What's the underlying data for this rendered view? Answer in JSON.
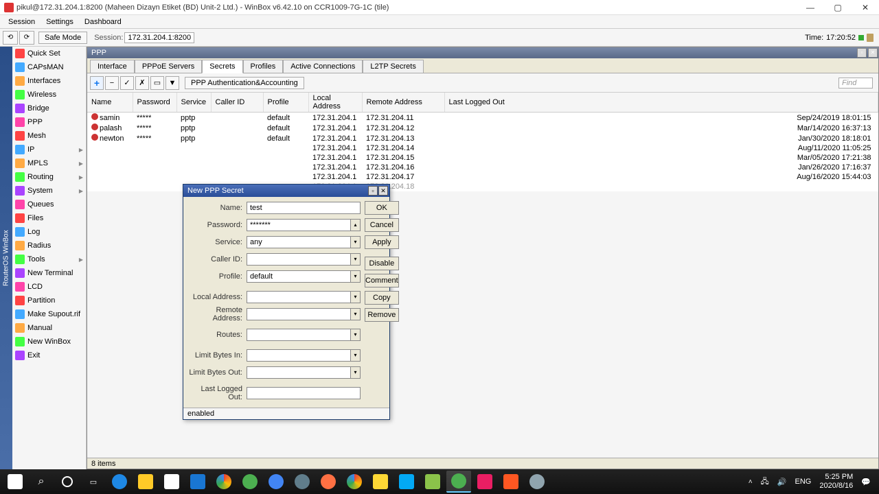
{
  "window": {
    "title": "pikul@172.31.204.1:8200 (Maheen Dizayn Etiket (BD) Unit-2 Ltd.) - WinBox v6.42.10 on CCR1009-7G-1C (tile)"
  },
  "menubar": [
    "Session",
    "Settings",
    "Dashboard"
  ],
  "toolbar": {
    "safe_mode": "Safe Mode",
    "session_label": "Session:",
    "session_value": "172.31.204.1:8200",
    "time_label": "Time:",
    "time_value": "17:20:52"
  },
  "sidebar": {
    "rail": "RouterOS WinBox",
    "items": [
      {
        "label": "Quick Set",
        "arrow": false
      },
      {
        "label": "CAPsMAN",
        "arrow": false
      },
      {
        "label": "Interfaces",
        "arrow": false
      },
      {
        "label": "Wireless",
        "arrow": false
      },
      {
        "label": "Bridge",
        "arrow": false
      },
      {
        "label": "PPP",
        "arrow": false
      },
      {
        "label": "Mesh",
        "arrow": false
      },
      {
        "label": "IP",
        "arrow": true
      },
      {
        "label": "MPLS",
        "arrow": true
      },
      {
        "label": "Routing",
        "arrow": true
      },
      {
        "label": "System",
        "arrow": true
      },
      {
        "label": "Queues",
        "arrow": false
      },
      {
        "label": "Files",
        "arrow": false
      },
      {
        "label": "Log",
        "arrow": false
      },
      {
        "label": "Radius",
        "arrow": false
      },
      {
        "label": "Tools",
        "arrow": true
      },
      {
        "label": "New Terminal",
        "arrow": false
      },
      {
        "label": "LCD",
        "arrow": false
      },
      {
        "label": "Partition",
        "arrow": false
      },
      {
        "label": "Make Supout.rif",
        "arrow": false
      },
      {
        "label": "Manual",
        "arrow": false
      },
      {
        "label": "New WinBox",
        "arrow": false
      },
      {
        "label": "Exit",
        "arrow": false
      }
    ]
  },
  "ppp": {
    "title": "PPP",
    "tabs": [
      "Interface",
      "PPPoE Servers",
      "Secrets",
      "Profiles",
      "Active Connections",
      "L2TP Secrets"
    ],
    "active_tab": 2,
    "auth_btn": "PPP Authentication&Accounting",
    "find_placeholder": "Find",
    "columns": [
      "Name",
      "Password",
      "Service",
      "Caller ID",
      "Profile",
      "Local Address",
      "Remote Address",
      "Last Logged Out"
    ],
    "rows": [
      {
        "name": "samin",
        "pwd": "*****",
        "svc": "pptp",
        "cid": "",
        "profile": "default",
        "local": "172.31.204.1",
        "remote": "172.31.204.11",
        "last": "Sep/24/2019 18:01:15",
        "grey": false
      },
      {
        "name": "palash",
        "pwd": "*****",
        "svc": "pptp",
        "cid": "",
        "profile": "default",
        "local": "172.31.204.1",
        "remote": "172.31.204.12",
        "last": "Mar/14/2020 16:37:13",
        "grey": false
      },
      {
        "name": "newton",
        "pwd": "*****",
        "svc": "pptp",
        "cid": "",
        "profile": "default",
        "local": "172.31.204.1",
        "remote": "172.31.204.13",
        "last": "Jan/30/2020 18:18:01",
        "grey": false
      },
      {
        "name": "",
        "pwd": "",
        "svc": "",
        "cid": "",
        "profile": "",
        "local": "172.31.204.1",
        "remote": "172.31.204.14",
        "last": "Aug/11/2020 11:05:25",
        "grey": false
      },
      {
        "name": "",
        "pwd": "",
        "svc": "",
        "cid": "",
        "profile": "",
        "local": "172.31.204.1",
        "remote": "172.31.204.15",
        "last": "Mar/05/2020 17:21:38",
        "grey": false
      },
      {
        "name": "",
        "pwd": "",
        "svc": "",
        "cid": "",
        "profile": "",
        "local": "172.31.204.1",
        "remote": "172.31.204.16",
        "last": "Jan/26/2020 17:16:37",
        "grey": false
      },
      {
        "name": "",
        "pwd": "",
        "svc": "",
        "cid": "",
        "profile": "",
        "local": "172.31.204.1",
        "remote": "172.31.204.17",
        "last": "Aug/16/2020 15:44:03",
        "grey": false
      },
      {
        "name": "",
        "pwd": "",
        "svc": "",
        "cid": "",
        "profile": "",
        "local": "172.31.204.1",
        "remote": "172.31.204.18",
        "last": "",
        "grey": true
      }
    ],
    "status": "8 items"
  },
  "dialog": {
    "title": "New PPP Secret",
    "fields": {
      "name_label": "Name:",
      "name_value": "test",
      "password_label": "Password:",
      "password_value": "*******",
      "service_label": "Service:",
      "service_value": "any",
      "callerid_label": "Caller ID:",
      "callerid_value": "",
      "profile_label": "Profile:",
      "profile_value": "default",
      "localaddr_label": "Local Address:",
      "localaddr_value": "",
      "remoteaddr_label": "Remote Address:",
      "remoteaddr_value": "",
      "routes_label": "Routes:",
      "routes_value": "",
      "limitin_label": "Limit Bytes In:",
      "limitin_value": "",
      "limitout_label": "Limit Bytes Out:",
      "limitout_value": "",
      "lastlogged_label": "Last Logged Out:",
      "lastlogged_value": ""
    },
    "buttons": {
      "ok": "OK",
      "cancel": "Cancel",
      "apply": "Apply",
      "disable": "Disable",
      "comment": "Comment",
      "copy": "Copy",
      "remove": "Remove"
    },
    "status": "enabled"
  },
  "taskbar": {
    "tray": {
      "lang": "ENG",
      "time": "5:25 PM",
      "date": "2020/8/16"
    }
  }
}
